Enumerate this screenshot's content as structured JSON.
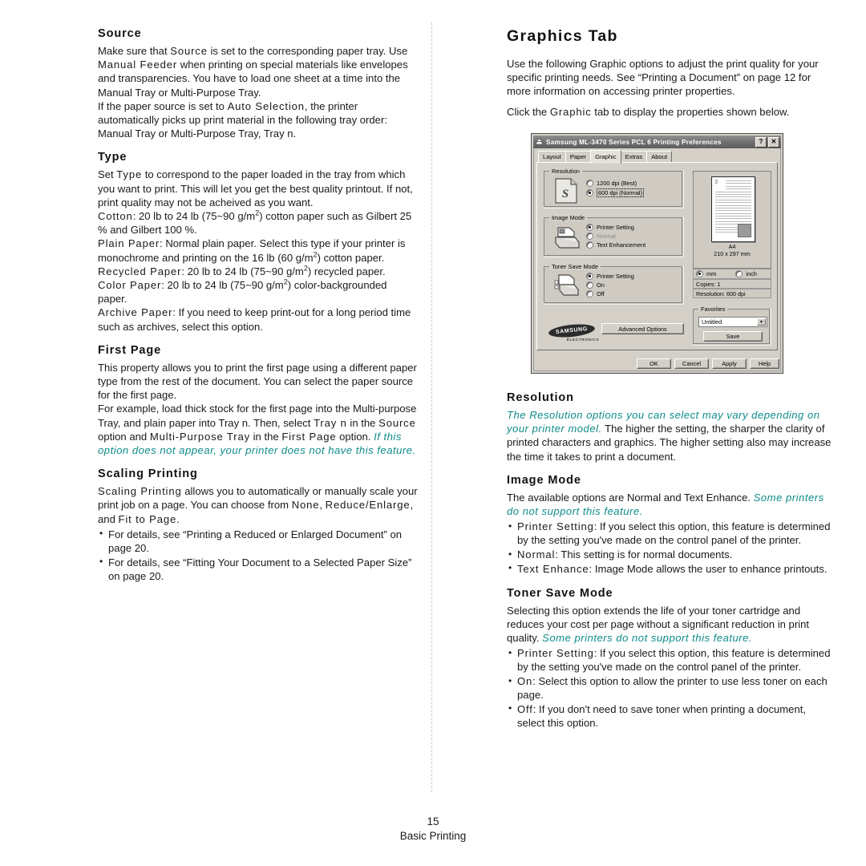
{
  "footer": {
    "page_number": "15",
    "chapter": "Basic Printing"
  },
  "colors": {
    "teal_accent": "#0e8b8b",
    "dialog_face": "#d4d0c8",
    "titlebar": "#6e6e6e"
  },
  "left_column": {
    "source": {
      "heading": "Source",
      "p1_a": "Make sure that ",
      "p1_term1": "Source",
      "p1_b": " is set to the corresponding paper tray. Use ",
      "p1_term2": "Manual Feeder",
      "p1_c": " when printing on special materials like envelopes and transparencies. You have to load one sheet at a time into the Manual Tray or Multi-Purpose Tray.",
      "p2_a": "If the paper source is set to ",
      "p2_term": "Auto Selection",
      "p2_b": ", the printer automatically picks up print material in the following tray order: Manual Tray or Multi-Purpose Tray, Tray n."
    },
    "type": {
      "heading": "Type",
      "intro": "Set Type to correspond to the paper loaded in the tray from which you want to print. This will let you get the best quality printout. If not, print quality may not be acheived as you want.",
      "intro_term": "Type",
      "items": [
        {
          "term": "Cotton",
          "body_pre": ": 20 lb to 24 lb (75~90 g/m",
          "sup": "2",
          "body_post": ") cotton paper such as Gilbert 25 % and Gilbert 100 %."
        },
        {
          "term": "Plain Paper",
          "body_pre": ": Normal plain paper. Select this type if your printer is monochrome and printing on the 16 lb (60 g/m",
          "sup": "2",
          "body_post": ") cotton paper."
        },
        {
          "term": "Recycled Paper",
          "body_pre": ": 20 lb to 24 lb (75~90 g/m",
          "sup": "2",
          "body_post": ") recycled paper."
        },
        {
          "term": "Color Paper",
          "body_pre": ": 20 lb to 24 lb (75~90 g/m",
          "sup": "2",
          "body_post": ") color-backgrounded paper."
        },
        {
          "term": "Archive Paper",
          "body_pre": ": If you need to keep print-out for a long period time such as archives, select this option.",
          "sup": "",
          "body_post": ""
        }
      ]
    },
    "first_page": {
      "heading": "First Page",
      "p1": "This property allows you to print the first page using a different paper type from the rest of the document. You can select the paper source for the first page.",
      "p2_a": "For example, load thick stock for the first page into the Multi-purpose Tray, and plain paper into Tray n. Then, select ",
      "p2_t1": "Tray n",
      "p2_b": " in the ",
      "p2_t2": "Source",
      "p2_c": " option and ",
      "p2_t3": "Multi-Purpose Tray",
      "p2_d": " in the ",
      "p2_t4": "First Page",
      "p2_e": " option. ",
      "p2_note": "If this option does not appear, your printer does not have this feature."
    },
    "scaling": {
      "heading": "Scaling Printing",
      "p1_term": "Scaling Printing",
      "p1_a": " allows you to automatically or manually scale your print job on a page. You can choose from ",
      "p1_t1": "None",
      "p1_b": ", ",
      "p1_t2": "Reduce/Enlarge",
      "p1_c": ", and ",
      "p1_t3": "Fit to Page",
      "p1_d": ".",
      "bullets": [
        "For details, see “Printing a Reduced or Enlarged Document” on page 20.",
        "For details, see “Fitting Your Document to a Selected Paper Size” on page 20."
      ]
    }
  },
  "right_column": {
    "chapter_heading": "Graphics Tab",
    "intro_p1": "Use the following Graphic options to adjust the print quality for your specific printing needs. See “Printing a Document” on page 12 for more information on accessing printer properties.",
    "intro_p2_a": "Click the ",
    "intro_p2_term": "Graphic",
    "intro_p2_b": " tab to display the properties shown below.",
    "resolution": {
      "heading": "Resolution",
      "note": "The Resolution options you can select may vary depending on your printer model.",
      "body": " The higher the setting, the sharper the clarity of printed characters and graphics. The higher setting also may increase the time it takes to print a document."
    },
    "image_mode": {
      "heading": "Image Mode",
      "body": "The available options are Normal and Text Enhance. ",
      "note": "Some printers do not support this feature.",
      "bullets": [
        {
          "term": "Printer Setting",
          "body": ": If you select this option, this feature is determined by the setting you've made on the control panel of the printer."
        },
        {
          "term": "Normal",
          "body": ": This setting is for normal documents."
        },
        {
          "term": "Text Enhance",
          "body": ": Image Mode allows the user to enhance printouts."
        }
      ]
    },
    "toner_save_mode": {
      "heading": "Toner Save Mode",
      "body": "Selecting this option extends the life of your toner cartridge and reduces your cost per page without a significant reduction in print quality. ",
      "note": "Some printers do not support this feature.",
      "bullets": [
        {
          "term": "Printer Setting",
          "body": ": If you select this option, this feature is determined by the setting you've made on the control panel of the printer."
        },
        {
          "term": "On",
          "body": ": Select this option to allow the printer to use less toner on each page."
        },
        {
          "term": "Off",
          "body": ": If you don't need to save toner when printing a document, select this option."
        }
      ]
    }
  },
  "dialog": {
    "title": "Samsung ML-3470 Series PCL 6 Printing Preferences",
    "help_button": "?",
    "close_button": "✕",
    "tabs": [
      {
        "label": "Layout",
        "active": false
      },
      {
        "label": "Paper",
        "active": false
      },
      {
        "label": "Graphic",
        "active": true
      },
      {
        "label": "Extras",
        "active": false
      },
      {
        "label": "About",
        "active": false
      }
    ],
    "resolution_group": {
      "title": "Resolution",
      "options": [
        {
          "label": "1200 dpi (Best)",
          "selected": false,
          "focused": false
        },
        {
          "label": "600 dpi (Normal)",
          "selected": true,
          "focused": true
        }
      ],
      "icon_letter": "S"
    },
    "image_mode_group": {
      "title": "Image Mode",
      "options": [
        {
          "label": "Printer Setting",
          "selected": true,
          "disabled": false
        },
        {
          "label": "Normal",
          "selected": false,
          "disabled": true
        },
        {
          "label": "Text Enhancement",
          "selected": false,
          "disabled": false
        }
      ]
    },
    "toner_group": {
      "title": "Toner Save Mode",
      "options": [
        {
          "label": "Printer Setting",
          "selected": true,
          "disabled": false
        },
        {
          "label": "On",
          "selected": false,
          "disabled": false
        },
        {
          "label": "Off",
          "selected": false,
          "disabled": false
        }
      ]
    },
    "preview": {
      "paper_size": "A4",
      "dimensions": "210 x 297 mm",
      "units": [
        {
          "label": "mm",
          "selected": true
        },
        {
          "label": "inch",
          "selected": false
        }
      ],
      "copies": "Copies: 1",
      "resolution": "Resolution: 600 dpi",
      "sheet_logo": "S"
    },
    "favorites": {
      "title": "Favorites",
      "selected_value": "Untitled",
      "save_button": "Save",
      "dropdown_arrow": "▼"
    },
    "advanced_button": "Advanced Options",
    "brand": {
      "name": "SAMSUNG",
      "sub": "ELECTRONICS"
    },
    "action_buttons": [
      "OK",
      "Cancel",
      "Apply",
      "Help"
    ]
  }
}
